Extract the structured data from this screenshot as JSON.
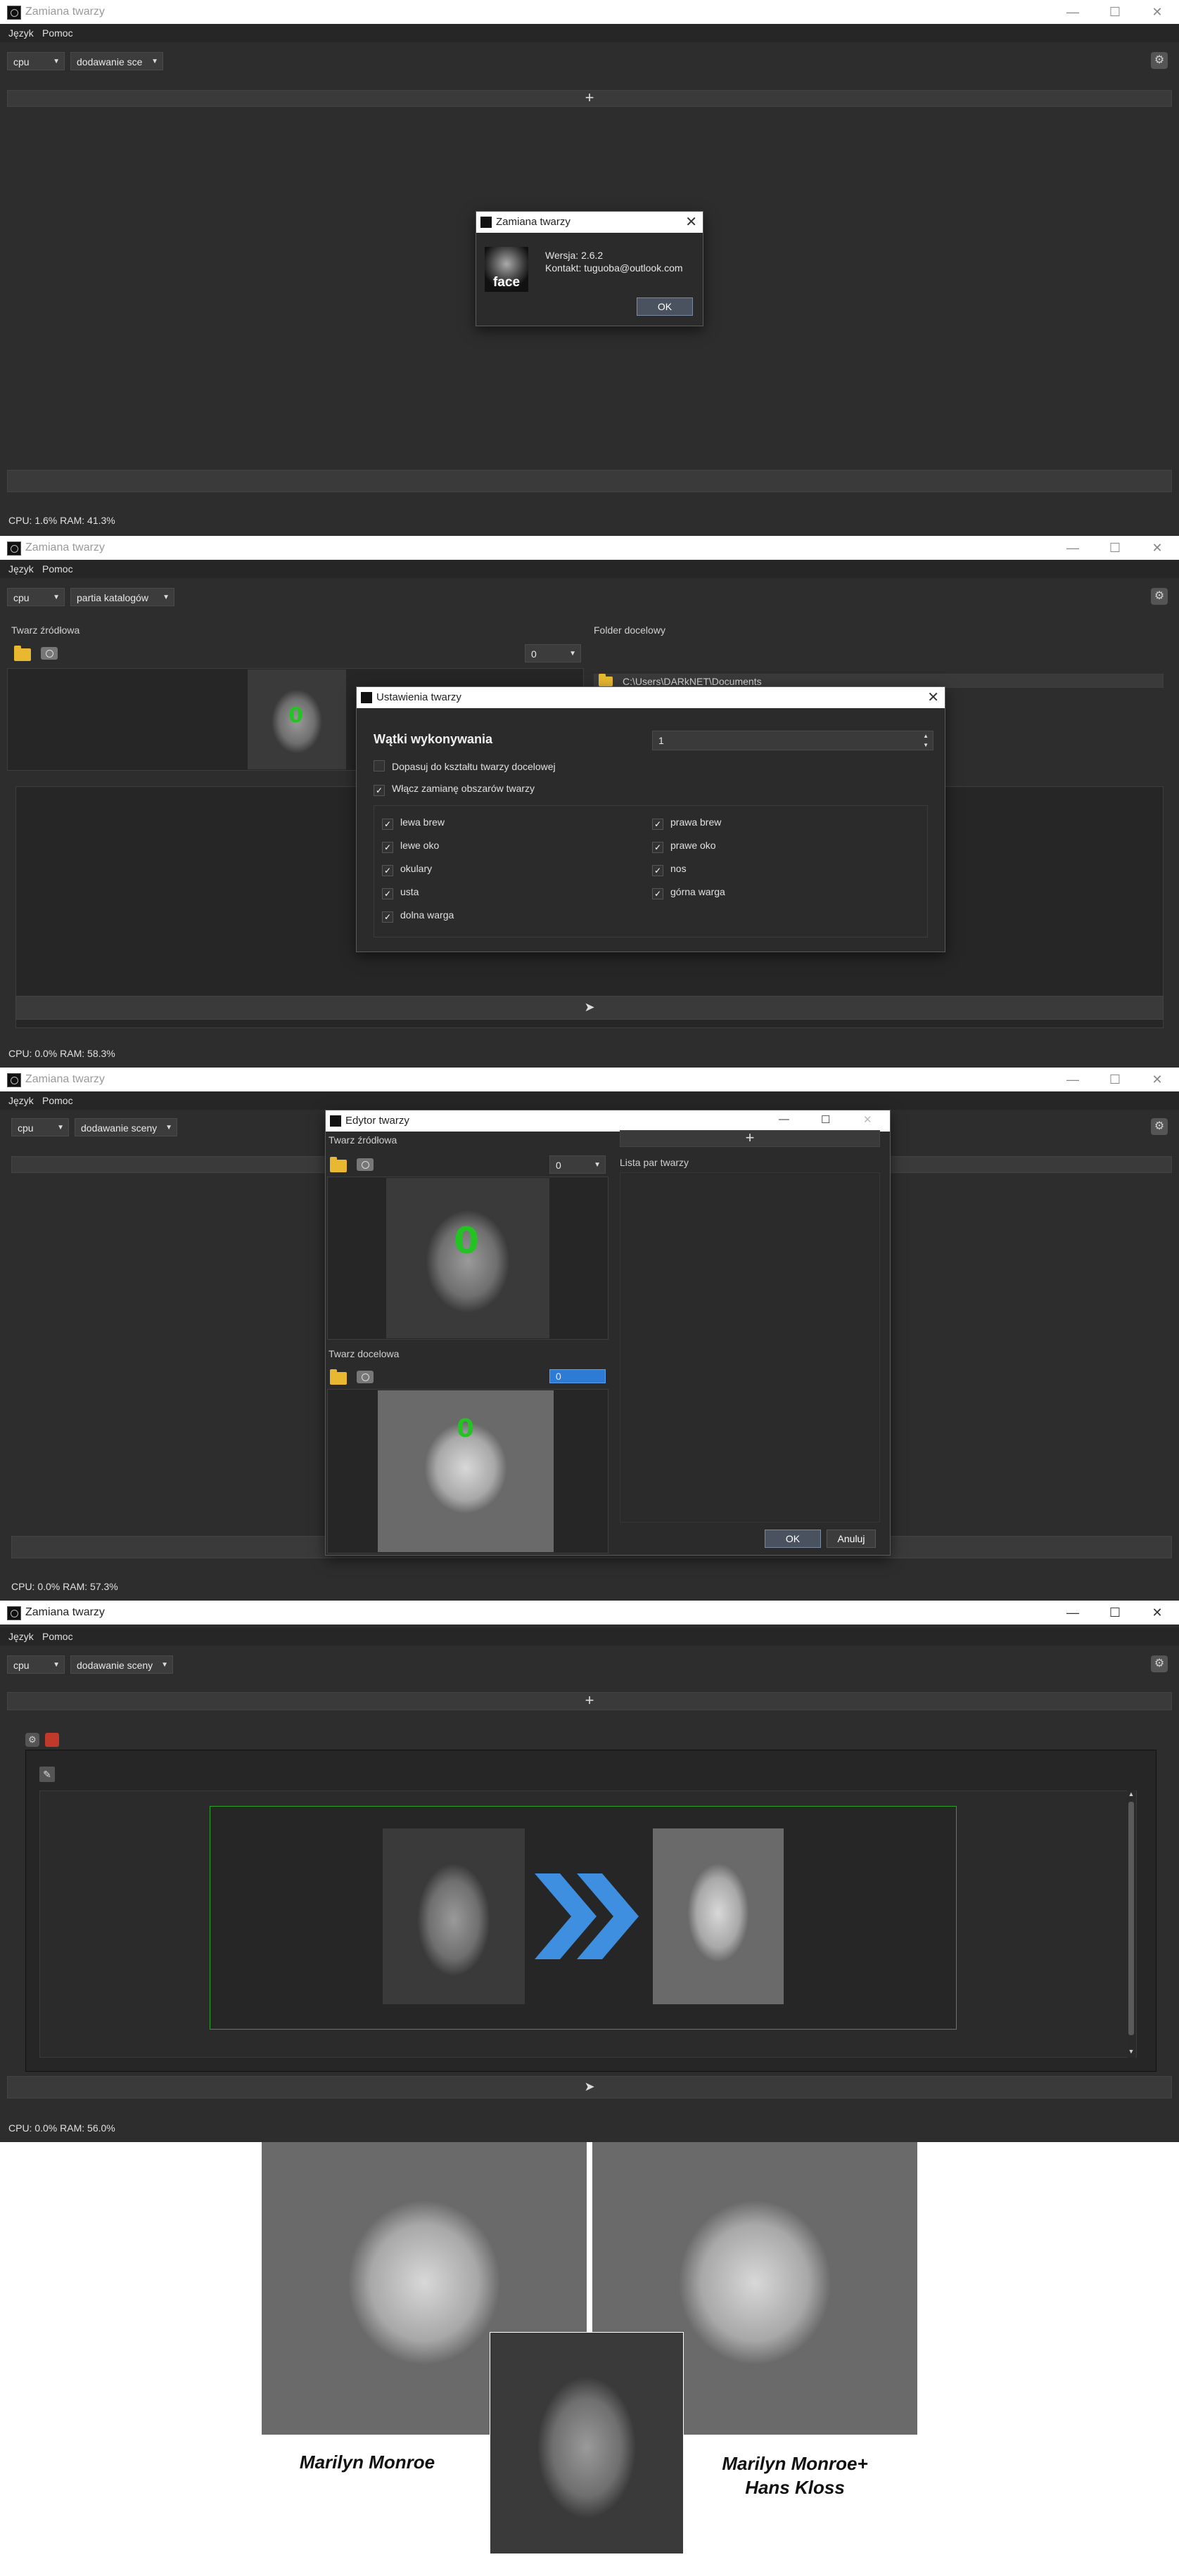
{
  "app": {
    "title": "Zamiana twarzy",
    "menu_language": "Język",
    "menu_help": "Pomoc",
    "device": "cpu",
    "title_controls": {
      "minimize": "—",
      "maximize": "☐",
      "close": "✕"
    }
  },
  "panel1": {
    "mode": "dodawanie sce",
    "add_symbol": "+",
    "status": "CPU: 1.6%  RAM: 41.3%",
    "about": {
      "title": "Zamiana twarzy",
      "logo_text": "face",
      "version": "Wersja: 2.6.2",
      "contact": "Kontakt: tuguoba@outlook.com",
      "ok": "OK"
    }
  },
  "panel2": {
    "mode": "partia katalogów",
    "source_label": "Twarz źródłowa",
    "target_label": "Folder docelowy",
    "index": "0",
    "face_marker": "0",
    "target_path": "C:\\Users\\DARkNET\\Documents",
    "run_symbol": "➤",
    "status": "CPU: 0.0%  RAM: 58.3%",
    "settings": {
      "title": "Ustawienia twarzy",
      "threads_label": "Wątki wykonywania",
      "threads_value": "1",
      "fit_shape": "Dopasuj do kształtu twarzy docelowej",
      "enable_regions": "Włącz zamianę obszarów twarzy",
      "regions_left": [
        "lewa brew",
        "lewe oko",
        "okulary",
        "usta",
        "dolna warga"
      ],
      "regions_right": [
        "prawa brew",
        "prawe oko",
        "nos",
        "górna warga"
      ]
    }
  },
  "panel3": {
    "mode": "dodawanie sceny",
    "status": "CPU: 0.0%  RAM: 57.3%",
    "editor": {
      "title": "Edytor twarzy",
      "source_label": "Twarz źródłowa",
      "target_label": "Twarz docelowa",
      "index": "0",
      "target_index": "0",
      "face_marker": "0",
      "add_symbol": "+",
      "pairs_label": "Lista par twarzy",
      "ok": "OK",
      "cancel": "Anuluj"
    }
  },
  "panel4": {
    "mode": "dodawanie sceny",
    "add_symbol": "+",
    "run_symbol": "➤",
    "status": "CPU: 0.0%  RAM: 56.0%",
    "pair_arrow": "»"
  },
  "comparison": {
    "left_caption": "Marilyn Monroe",
    "right_caption": "Marilyn Monroe+ Hans Kloss"
  }
}
